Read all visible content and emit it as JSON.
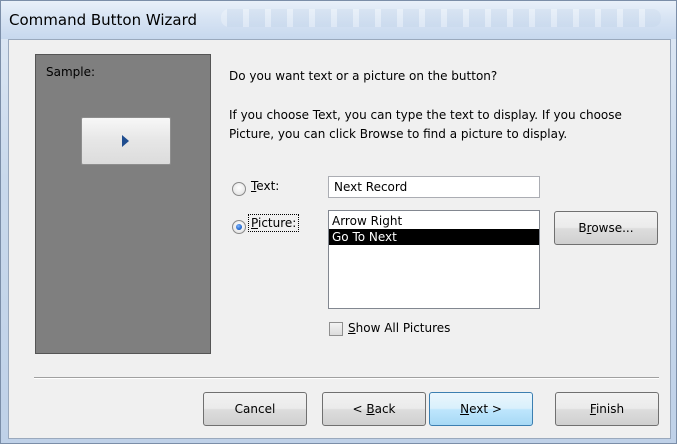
{
  "window": {
    "title": "Command Button Wizard"
  },
  "sample": {
    "label": "Sample:"
  },
  "prompt": {
    "question": "Do you want text or a picture on the button?",
    "line1": "If you choose Text, you can type the text to display.  If you choose",
    "line2": "Picture, you can click Browse to find a picture to display."
  },
  "options": {
    "text": {
      "access_key": "T",
      "rest": "ext:",
      "value": "Next Record",
      "checked": false
    },
    "picture": {
      "access_key": "P",
      "rest": "icture:",
      "checked": true
    }
  },
  "picture_list": {
    "items": [
      "Arrow Right",
      "Go To Next"
    ],
    "selected": "Go To Next"
  },
  "browse_button": {
    "pre": "B",
    "access_key": "r",
    "post": "owse..."
  },
  "show_all": {
    "access_key": "S",
    "rest": "how All Pictures",
    "checked": false
  },
  "footer": {
    "cancel": "Cancel",
    "back": {
      "pre": "< ",
      "access_key": "B",
      "post": "ack"
    },
    "next": {
      "access_key": "N",
      "post": "ext >"
    },
    "finish": {
      "access_key": "F",
      "post": "inish"
    }
  },
  "colors": {
    "accent": "#3c7fb1",
    "selection": "#000000",
    "sample_bg": "#7f7f7f"
  }
}
